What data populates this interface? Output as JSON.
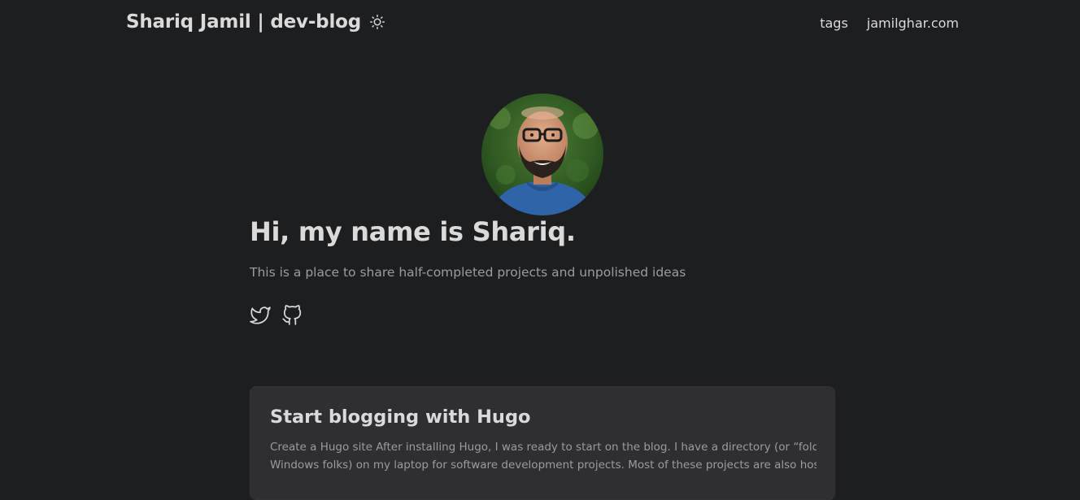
{
  "header": {
    "site_title": "Shariq Jamil | dev-blog",
    "theme_toggle_icon": "sun-icon",
    "nav": [
      {
        "label": "tags"
      },
      {
        "label": "jamilghar.com"
      }
    ]
  },
  "profile": {
    "avatar_alt": "Shariq",
    "title": "Hi, my name is Shariq.",
    "subtitle": "This is a place to share half-completed projects and unpolished ideas",
    "socials": [
      {
        "icon": "twitter-icon"
      },
      {
        "icon": "github-icon"
      }
    ]
  },
  "posts": [
    {
      "title": "Start blogging with Hugo",
      "summary_line1": "Create a Hugo site After installing Hugo, I was ready to start on the blog. I have a directory (or “folder” for",
      "summary_line2": "Windows folks) on my laptop for software development projects. Most of these projects are also hoste…"
    }
  ]
}
